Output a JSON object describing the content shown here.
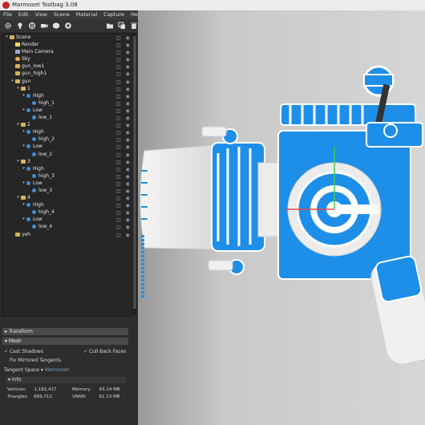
{
  "window": {
    "title": "Marmoset Toolbag 3.08"
  },
  "menu": [
    "File",
    "Edit",
    "View",
    "Scene",
    "Material",
    "Capture",
    "Help"
  ],
  "toolbar": {
    "left_icons": [
      "gear-icon",
      "light-icon",
      "sky-icon",
      "camera-icon",
      "object-icon",
      "render-icon"
    ],
    "right_icons": [
      "folder-icon",
      "duplicate-icon",
      "delete-icon"
    ]
  },
  "outline": {
    "items": [
      {
        "label": "Scene",
        "icon": "folder",
        "depth": 0,
        "expanded": true
      },
      {
        "label": "Render",
        "icon": "render",
        "depth": 1
      },
      {
        "label": "Main Camera",
        "icon": "cam",
        "depth": 1
      },
      {
        "label": "Sky",
        "icon": "sky",
        "depth": 1
      },
      {
        "label": "gun_low1",
        "icon": "folder",
        "depth": 1
      },
      {
        "label": "gun_high1",
        "icon": "folder",
        "depth": 1
      },
      {
        "label": "gun",
        "icon": "folder",
        "depth": 1,
        "expanded": true
      },
      {
        "label": "1",
        "icon": "folder",
        "depth": 2,
        "expanded": true
      },
      {
        "label": "High",
        "icon": "mesh",
        "depth": 3,
        "expanded": true
      },
      {
        "label": "high_1",
        "icon": "mesh",
        "depth": 4
      },
      {
        "label": "Low",
        "icon": "mesh",
        "depth": 3,
        "expanded": true
      },
      {
        "label": "low_1",
        "icon": "mesh",
        "depth": 4
      },
      {
        "label": "2",
        "icon": "folder",
        "depth": 2,
        "expanded": true
      },
      {
        "label": "High",
        "icon": "mesh",
        "depth": 3,
        "expanded": true
      },
      {
        "label": "high_2",
        "icon": "mesh",
        "depth": 4
      },
      {
        "label": "Low",
        "icon": "mesh",
        "depth": 3,
        "expanded": true
      },
      {
        "label": "low_2",
        "icon": "mesh",
        "depth": 4
      },
      {
        "label": "3",
        "icon": "folder",
        "depth": 2,
        "expanded": true
      },
      {
        "label": "High",
        "icon": "mesh",
        "depth": 3,
        "expanded": true
      },
      {
        "label": "high_3",
        "icon": "mesh",
        "depth": 4
      },
      {
        "label": "Low",
        "icon": "mesh",
        "depth": 3,
        "expanded": true
      },
      {
        "label": "low_3",
        "icon": "mesh",
        "depth": 4
      },
      {
        "label": "4",
        "icon": "folder",
        "depth": 2,
        "expanded": true
      },
      {
        "label": "High",
        "icon": "mesh",
        "depth": 3,
        "expanded": true
      },
      {
        "label": "high_4",
        "icon": "mesh",
        "depth": 4
      },
      {
        "label": "Low",
        "icon": "mesh",
        "depth": 3,
        "expanded": true
      },
      {
        "label": "low_4",
        "icon": "mesh",
        "depth": 4
      },
      {
        "label": "yeh",
        "icon": "folder",
        "depth": 1
      }
    ]
  },
  "properties": {
    "transform_label": "Transform",
    "mesh_label": "Mesh",
    "cast_shadows": "Cast Shadows",
    "cull_back_faces": "Cull Back Faces",
    "fix_mirrored": "Fix Mirrored Tangents",
    "tangent_space_label": "Tangent Space",
    "tangent_space_value": "Marmoset",
    "info_label": "Info",
    "vertices_label": "Vertices:",
    "vertices_value": "1,181,417",
    "triangles_label": "Triangles:",
    "triangles_value": "669,712",
    "memory_label": "Memory:",
    "memory_value": "93.24 MB",
    "vram_label": "VRAM:",
    "vram_value": "61.13 MB"
  },
  "colors": {
    "accent": "#1e8fe8",
    "panel": "#2d2d2d",
    "highlight": "#ffffff"
  }
}
